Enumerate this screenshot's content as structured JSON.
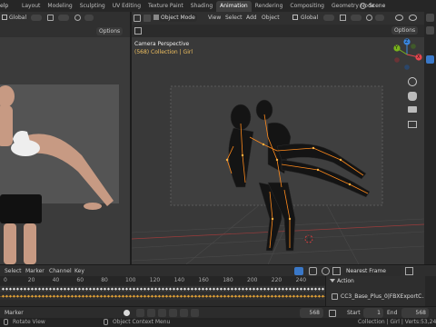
{
  "topbar": {
    "help": "elp",
    "workspaces": [
      "Layout",
      "Modeling",
      "Sculpting",
      "UV Editing",
      "Texture Paint",
      "Shading",
      "Animation",
      "Rendering",
      "Compositing",
      "Geometry Node"
    ],
    "active_workspace": "Animation",
    "scene": "Scene"
  },
  "left_header": {
    "orientation": "Global",
    "options": "Options"
  },
  "right_header": {
    "mode": "Object Mode",
    "menus": [
      "View",
      "Select",
      "Add",
      "Object"
    ],
    "orientation": "Global",
    "options": "Options"
  },
  "viewport": {
    "camera_label": "Camera Perspective",
    "collection_label": "(568) Collection | Girl"
  },
  "gizmo": {
    "axes": [
      "Y",
      "X",
      "Z"
    ]
  },
  "timeline": {
    "menus": [
      "Select",
      "Marker",
      "Channel",
      "Key"
    ],
    "snap": "Nearest Frame",
    "ticks": [
      "0",
      "20",
      "40",
      "60",
      "80",
      "100",
      "120",
      "140",
      "160",
      "180",
      "200",
      "220",
      "240"
    ],
    "action_title": "Action",
    "action_name": "CC3_Base_Plus_0|FBXExportC...",
    "marker_menu": "Marker",
    "frame": "568",
    "start_label": "Start",
    "start": "1",
    "end_label": "End",
    "end": "568"
  },
  "statusbar": {
    "rotate": "Rotate View",
    "context": "Object Context Menu",
    "right": "Collection | Girl | Verts:53,247 | F"
  },
  "colors": {
    "active_tab": "#3f3f3f",
    "viewport_bg": "#393939",
    "keyframe": "#e0a23a",
    "axis_x": "#e8464f",
    "axis_y": "#79b31c",
    "axis_z": "#3a86e0",
    "rig_orange": "#ff8a1c"
  }
}
